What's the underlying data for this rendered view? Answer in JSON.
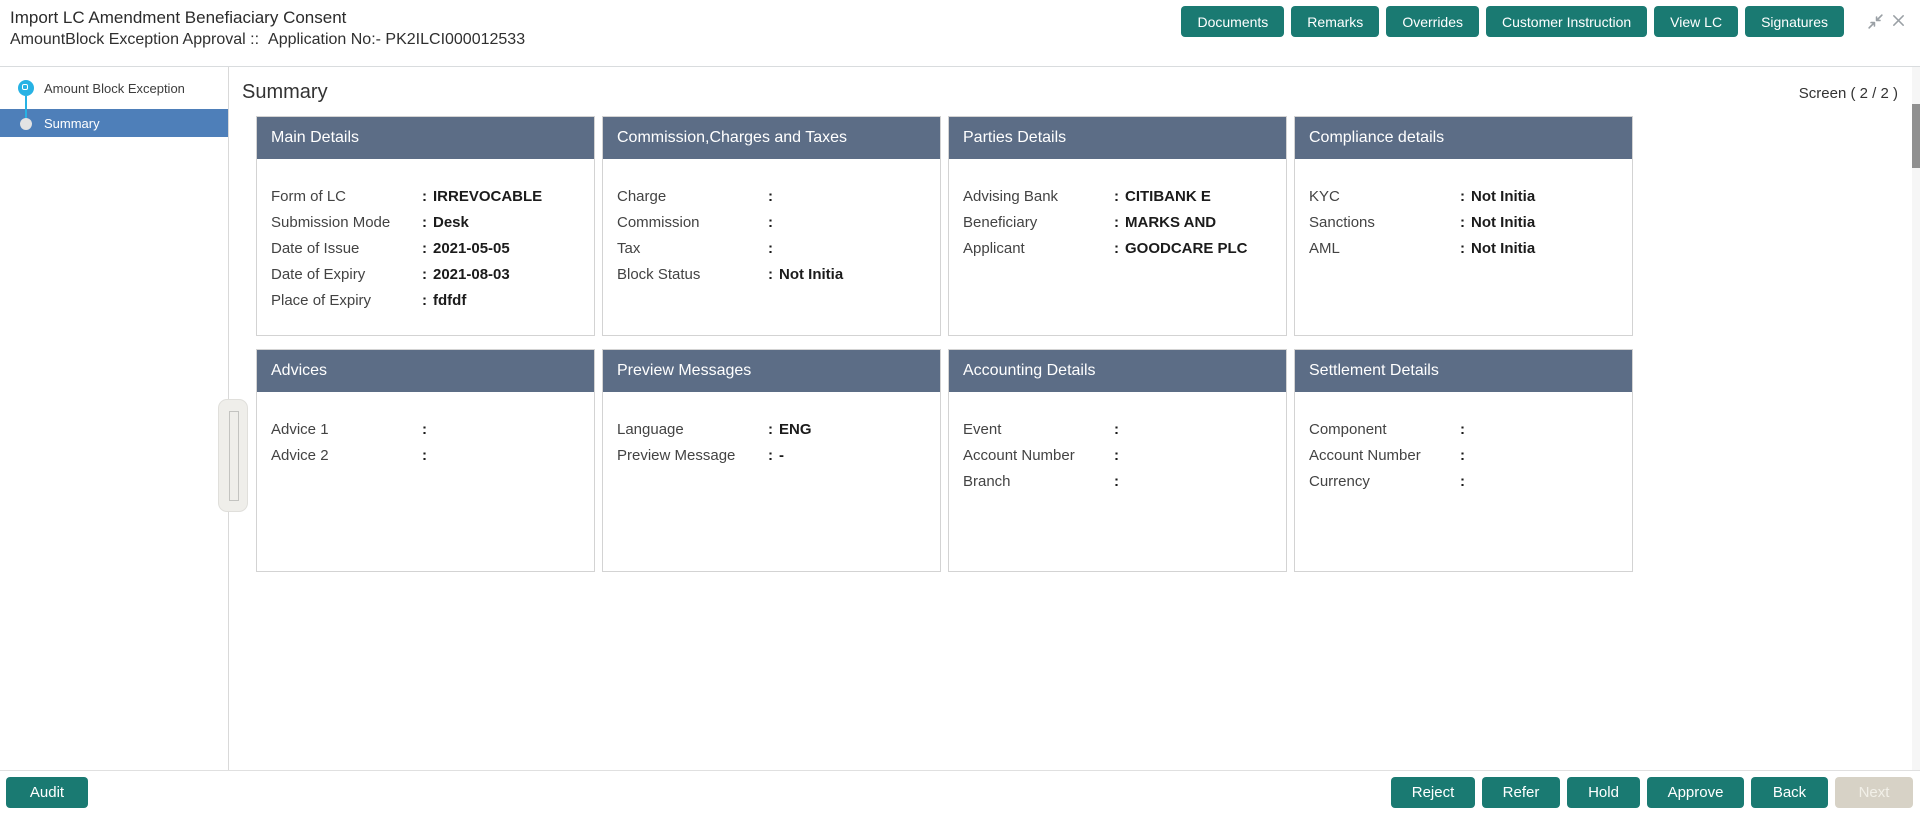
{
  "ui": {
    "colon": ":"
  },
  "colors": {
    "accent_teal": "#1a7a72",
    "tile_header_slate": "#5c6d86",
    "sidebar_active_blue": "#4e7fb9",
    "step_icon_cyan": "#27b2e4"
  },
  "header": {
    "title": "Import LC Amendment Benefiaciary Consent",
    "stage": "AmountBlock Exception Approval ::",
    "application_no": "Application No:- PK2ILCI000012533",
    "buttons": [
      {
        "label": "Documents"
      },
      {
        "label": "Remarks"
      },
      {
        "label": "Overrides"
      },
      {
        "label": "Customer Instruction"
      },
      {
        "label": "View LC"
      },
      {
        "label": "Signatures"
      }
    ]
  },
  "sidebar": {
    "items": [
      {
        "label": "Amount Block Exception",
        "active": false
      },
      {
        "label": "Summary",
        "active": true
      }
    ]
  },
  "content": {
    "title": "Summary",
    "screen_indicator": "Screen ( 2 / 2 )"
  },
  "tiles": [
    {
      "title": "Main Details",
      "fields": [
        {
          "label": "Form of LC",
          "value": "IRREVOCABLE"
        },
        {
          "label": "Submission Mode",
          "value": "Desk"
        },
        {
          "label": "Date of Issue",
          "value": "2021-05-05"
        },
        {
          "label": "Date of Expiry",
          "value": "2021-08-03"
        },
        {
          "label": "Place of Expiry",
          "value": "fdfdf"
        }
      ]
    },
    {
      "title": "Commission,Charges and Taxes",
      "fields": [
        {
          "label": "Charge",
          "value": ""
        },
        {
          "label": "Commission",
          "value": ""
        },
        {
          "label": "Tax",
          "value": ""
        },
        {
          "label": "Block Status",
          "value": "Not Initia"
        }
      ]
    },
    {
      "title": "Parties Details",
      "fields": [
        {
          "label": "Advising Bank",
          "value": "CITIBANK E"
        },
        {
          "label": "Beneficiary",
          "value": "MARKS AND"
        },
        {
          "label": "Applicant",
          "value": "GOODCARE PLC"
        }
      ]
    },
    {
      "title": "Compliance details",
      "fields": [
        {
          "label": "KYC",
          "value": "Not Initia"
        },
        {
          "label": "Sanctions",
          "value": "Not Initia"
        },
        {
          "label": "AML",
          "value": "Not Initia"
        }
      ]
    },
    {
      "title": "Advices",
      "fields": [
        {
          "label": "Advice 1",
          "value": ""
        },
        {
          "label": "Advice 2",
          "value": ""
        }
      ]
    },
    {
      "title": "Preview Messages",
      "fields": [
        {
          "label": "Language",
          "value": "ENG"
        },
        {
          "label": "Preview Message",
          "value": "-"
        }
      ]
    },
    {
      "title": "Accounting Details",
      "fields": [
        {
          "label": "Event",
          "value": ""
        },
        {
          "label": "Account Number",
          "value": ""
        },
        {
          "label": "Branch",
          "value": ""
        }
      ]
    },
    {
      "title": "Settlement Details",
      "fields": [
        {
          "label": "Component",
          "value": ""
        },
        {
          "label": "Account Number",
          "value": ""
        },
        {
          "label": "Currency",
          "value": ""
        }
      ]
    }
  ],
  "footer": {
    "audit_label": "Audit",
    "actions": [
      {
        "label": "Reject",
        "disabled": false
      },
      {
        "label": "Refer",
        "disabled": false
      },
      {
        "label": "Hold",
        "disabled": false
      },
      {
        "label": "Approve",
        "disabled": false
      },
      {
        "label": "Back",
        "disabled": false
      },
      {
        "label": "Next",
        "disabled": true
      }
    ]
  }
}
